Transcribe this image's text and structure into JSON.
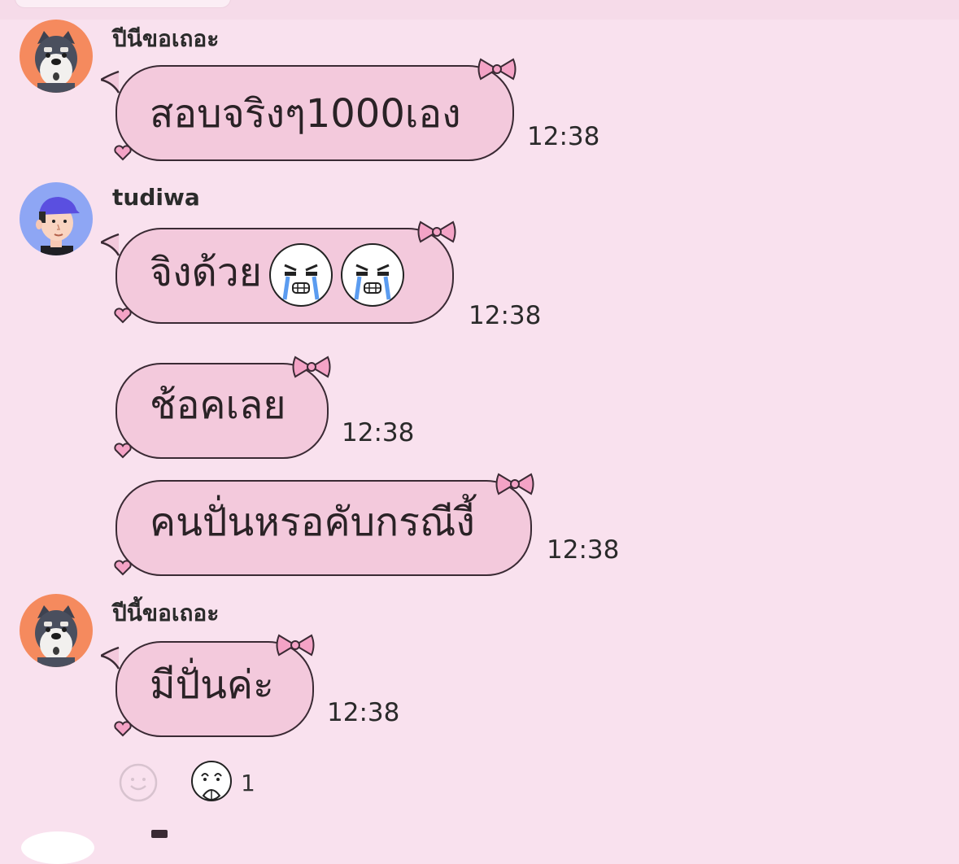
{
  "colors": {
    "background": "#f9e1ee",
    "bubble_fill": "#f3c9dc",
    "bubble_border": "#3a2a34",
    "bow": "#f4a3c6"
  },
  "messages": [
    {
      "sender": "ปีนีขอเถอะ",
      "avatar": "schnauzer-dog-avatar",
      "text": "สอบจริงๆ1000เอง",
      "time": "12:38"
    },
    {
      "sender": "tudiwa",
      "avatar": "boy-blue-cap-avatar",
      "text": "จิงด้วย",
      "stickers": [
        "crying-face-emoji",
        "crying-face-emoji"
      ],
      "time": "12:38"
    },
    {
      "text": "ช้อคเลย",
      "time": "12:38"
    },
    {
      "text": "คนปั่นหรอคับกรณีงี้",
      "time": "12:38"
    },
    {
      "sender": "ปีนี้ขอเถอะ",
      "avatar": "schnauzer-dog-avatar",
      "text": "มีปั่นค่ะ",
      "time": "12:38"
    }
  ],
  "reactions": {
    "add_icon": "smiley-add-reaction-icon",
    "items": [
      {
        "icon": "praying-face-sticker-icon",
        "count": "1"
      }
    ]
  }
}
